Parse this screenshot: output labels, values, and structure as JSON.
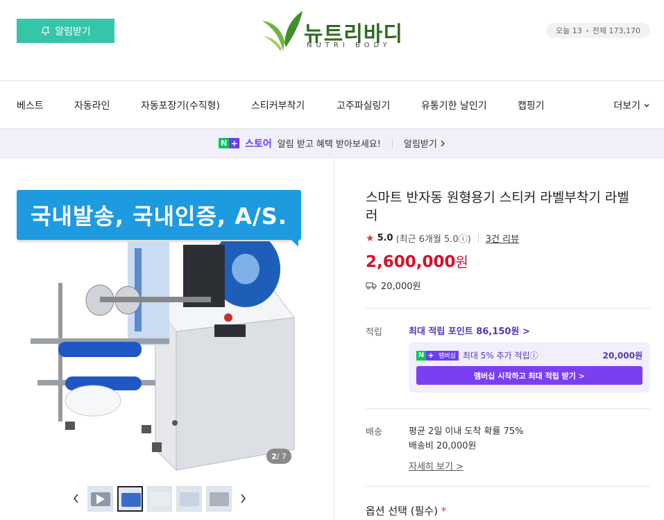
{
  "header": {
    "alarm_label": "알림받기",
    "logo_ko": "뉴트리바디",
    "logo_en": "NUTRI BODY",
    "visitor_today": "오늘 13",
    "visitor_total": "전체 173,170"
  },
  "nav": {
    "items": [
      "베스트",
      "자동라인",
      "자동포장기(수직형)",
      "스티커부착기",
      "고주파실링기",
      "유통기한 날인기",
      "캡핑기"
    ],
    "more_label": "더보기"
  },
  "store_banner": {
    "store_name": "스토어",
    "message": "알림 받고 혜택 받아보세요!",
    "cta": "알림받기"
  },
  "gallery": {
    "promo_text": "국내발송, 국내인증,  A/S.",
    "counter_current": "2",
    "counter_total": "/ 7"
  },
  "product": {
    "title": "스마트 반자동 원형용기 스티커 라벨부착기 라벨러",
    "rating": "5.0",
    "rating_recent": "(최근 6개월 5.0ⓘ)",
    "reviews": "3건 리뷰",
    "price": "2,600,000",
    "currency": "원",
    "shipping_fee": "20,000원"
  },
  "points": {
    "label": "적립",
    "max_points": "최대 적립 포인트 86,150원 >",
    "member_badge": "멤버십",
    "member_extra": "최대 5% 추가 적립ⓘ",
    "member_amount": "20,000원",
    "member_cta": "멤버십 시작하고 최대 적립 받기 >"
  },
  "shipping": {
    "label": "배송",
    "eta": "평균 2일 이내 도착 확률 75%",
    "fee": "배송비 20,000원",
    "detail": "자세히 보기 >"
  },
  "options": {
    "title": "옵션 선택 (필수)",
    "required_mark": "*"
  },
  "colors": {
    "accent_green": "#35c5a9",
    "price_red": "#d70f2d",
    "member_purple": "#7b3ff2"
  }
}
